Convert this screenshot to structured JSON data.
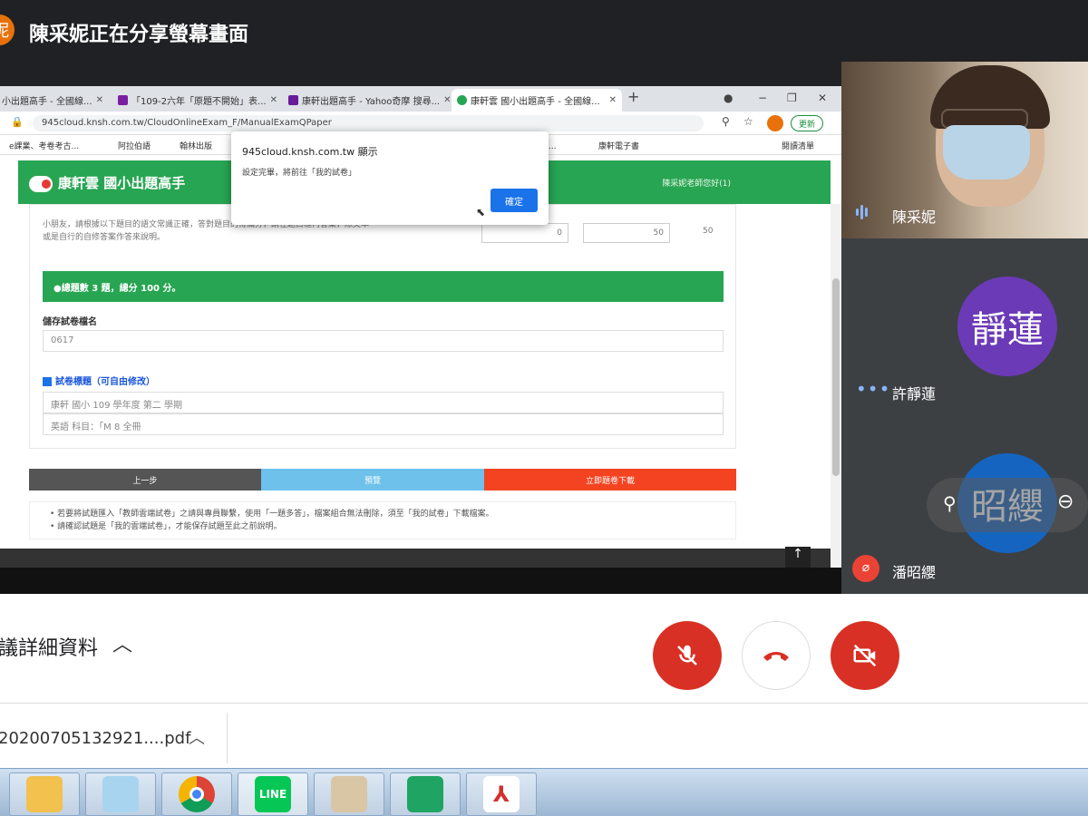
{
  "meet": {
    "presenter_avatar_char": "妮",
    "share_title": "陳采妮正在分享螢幕畫面",
    "details_label": "議詳細資料",
    "participants": [
      {
        "name": "陳采妮"
      },
      {
        "name": "許靜蓮",
        "avatar_text": "靜蓮",
        "avatar_color": "#6b3ab7"
      },
      {
        "name": "潘昭纓",
        "avatar_text": "昭纓",
        "avatar_color": "#1565c0"
      }
    ],
    "controls": {
      "mic": "mic-off-icon",
      "hangup": "hangup-icon",
      "camera": "camera-off-icon"
    }
  },
  "browser": {
    "tabs": [
      {
        "label": "小出題高手 - 全國線...",
        "color": "#e53935"
      },
      {
        "label": "「109-2六年「原題不開始」表...",
        "color": "#7b1fa2"
      },
      {
        "label": "康軒出題高手 - Yahoo奇摩 搜尋...",
        "color": "#6a1b9a"
      },
      {
        "label": "康軒雲 國小出題高手 - 全國線...",
        "color": "#27a552"
      }
    ],
    "url": "945cloud.knsh.com.tw/CloudOnlineExam_F/ManualExamQPaper",
    "profile_btn": "更新",
    "bookmarks": [
      "e課業、考卷考古...",
      "阿拉伯語",
      "翰林出版",
      "晨曦社群網...",
      "康軒電子書",
      "閱讀清單"
    ]
  },
  "site": {
    "logo": "康軒雲 國小出題高手",
    "user": "陳采妮老師您好(1)",
    "question_text": "小朋友，請根據以下題目的語文常識正確，答對題目的得滿分，請在題目框內答案，除文本或是自行的自修答案作答來說明。",
    "score1": "0",
    "score2": "50",
    "score3": "50",
    "total_bar": "●總題數 3 題，總分 100 分。",
    "save_name_label": "儲存試卷檔名",
    "save_name_value": "0617",
    "title_label": "試卷標題（可自由修改）",
    "title_line1": "康軒   國小 109   學年度 第二   學期",
    "title_line2": "英語 科目：「M 8 全冊",
    "btn_prev": "上一步",
    "btn_preview": "預覽",
    "btn_export": "立即題卷下載",
    "note1": "若要將試題匯入「教師雲端試卷」之請與專員聯繫，使用「一題多答」，檔案組合無法刪除，須至「我的試卷」下載檔案。",
    "note2": "請確認試題是「我的雲端試卷」，才能保存試題至此之前說明。"
  },
  "dialog": {
    "title": "945cloud.knsh.com.tw 顯示",
    "message": "設定完畢，將前往「我的試卷」",
    "ok": "確定"
  },
  "download": {
    "filename": "20200705132921....pdf"
  },
  "taskbar": {
    "apps": [
      "folder",
      "notepad",
      "chrome",
      "LINE",
      "paint",
      "green-app",
      "pdf"
    ]
  }
}
